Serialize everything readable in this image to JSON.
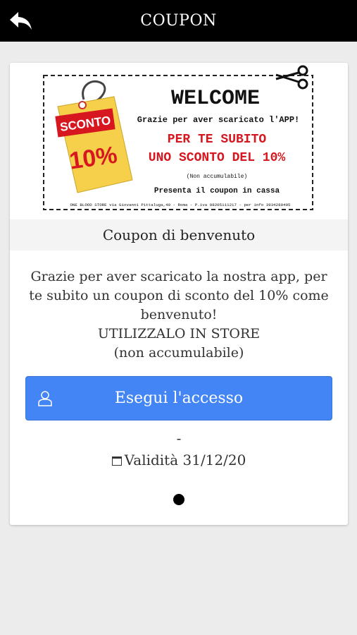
{
  "header": {
    "title": "COUPON",
    "back_icon": "back-arrow-icon"
  },
  "banner": {
    "welcome": "WELCOME",
    "thanks_line": "Grazie per aver scaricato l'APP!",
    "offer_line1": "PER TE SUBITO",
    "offer_line2": "UNO SCONTO DEL 10%",
    "note": "(Non accumulabile)",
    "present": "Presenta il coupon in cassa",
    "footer": "ONE BLOOD STORE via Giovanni Pittaluga,40 - Roma - P.iva 08205111217 - per info 3934280405",
    "tag_label": "SCONTO",
    "tag_value": "10%",
    "colors": {
      "accent_red": "#d7171f",
      "tag_yellow": "#f6d04a"
    }
  },
  "coupon": {
    "name": "Coupon di benvenuto",
    "description": "Grazie per aver scaricato la nostra app, per te subito un coupon di sconto del 10% come benvenuto!",
    "use_in_store": "UTILIZZALO IN STORE",
    "non_cumulative": "(non accumulabile)",
    "login_button": "Esegui l'accesso",
    "separator": "-",
    "validity": "Validità 31/12/20"
  },
  "colors": {
    "primary_button": "#4385f5",
    "topbar": "#000000"
  }
}
